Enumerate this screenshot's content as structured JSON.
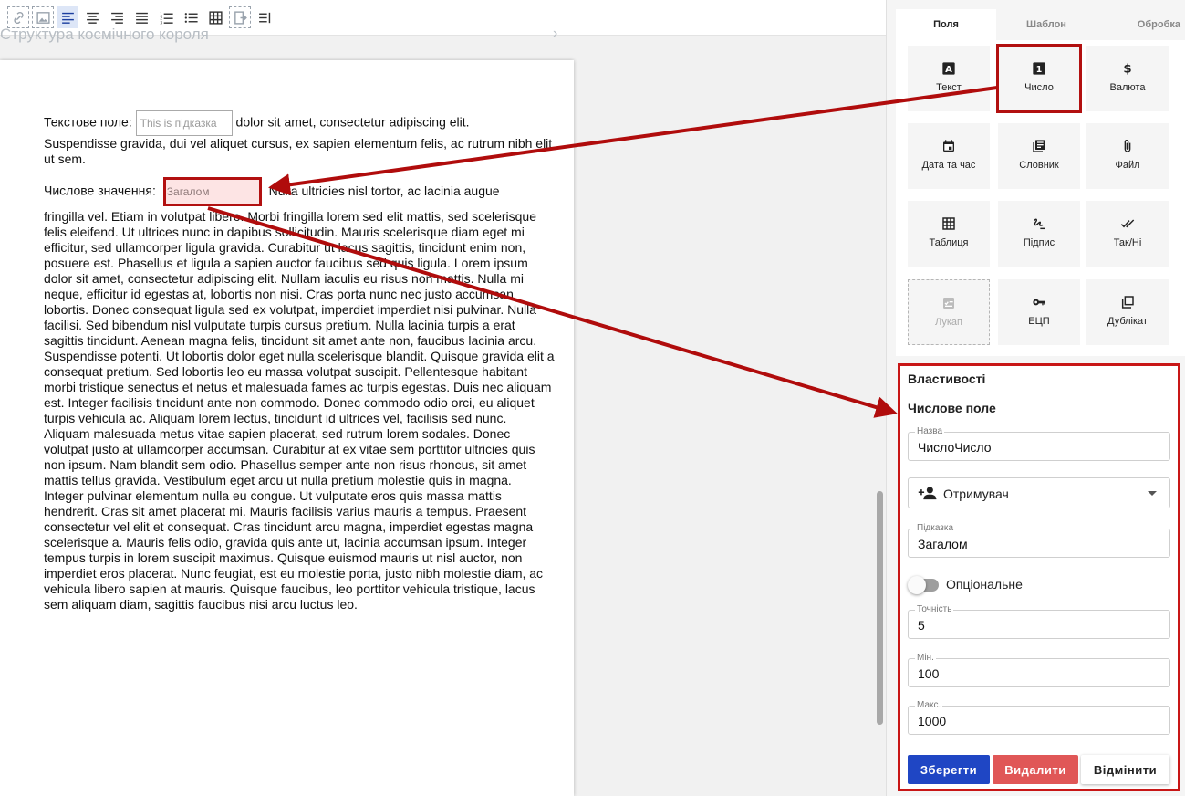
{
  "toolbar": {
    "buttons": [
      "link-icon",
      "image-icon",
      "align-left-icon",
      "align-center-icon",
      "align-right-icon",
      "align-justify-icon",
      "ordered-list-icon",
      "bullet-list-icon",
      "table-icon",
      "insert-field-icon",
      "text-direction-icon"
    ]
  },
  "document": {
    "faded_title": "Структура космічного короля",
    "p1_label": "Текстове поле:",
    "p1_placeholder": "This is підказка",
    "p1_after": " dolor sit amet, consectetur adipiscing elit.",
    "p1_rest": "Suspendisse gravida, dui vel aliquet cursus, ex sapien elementum felis, ac rutrum nibh elit ut sem.",
    "p2_label": "Числове значення:",
    "p2_placeholder": "Загалом",
    "p2_after": "Nulla ultricies nisl tortor, ac lacinia augue",
    "p2_body": "fringilla vel. Etiam in volutpat libero. Morbi fringilla lorem sed elit mattis, sed scelerisque felis eleifend. Ut ultrices nunc in dapibus sollicitudin. Mauris scelerisque diam eget mi efficitur, sed ullamcorper ligula gravida. Curabitur ut lacus sagittis, tincidunt enim non, posuere est. Phasellus et ligula a sapien auctor faucibus sed quis ligula. Lorem ipsum dolor sit amet, consectetur adipiscing elit. Nullam iaculis eu risus non mattis. Nulla mi neque, efficitur id egestas at, lobortis non nisi. Cras porta nunc nec justo accumsan lobortis. Donec consequat ligula sed ex volutpat, imperdiet imperdiet nisi pulvinar. Nulla facilisi. Sed bibendum nisl vulputate turpis cursus pretium. Nulla lacinia turpis a erat sagittis tincidunt. Aenean magna felis, tincidunt sit amet ante non, faucibus lacinia arcu. Suspendisse potenti. Ut lobortis dolor eget nulla scelerisque blandit. Quisque gravida elit a consequat pretium. Sed lobortis leo eu massa volutpat suscipit. Pellentesque habitant morbi tristique senectus et netus et malesuada fames ac turpis egestas. Duis nec aliquam est. Integer facilisis tincidunt ante non commodo. Donec commodo odio orci, eu aliquet turpis vehicula ac. Aliquam lorem lectus, tincidunt id ultrices vel, facilisis sed nunc. Aliquam malesuada metus vitae sapien placerat, sed rutrum lorem sodales. Donec volutpat justo at ullamcorper accumsan. Curabitur at ex vitae sem porttitor ultricies quis non ipsum. Nam blandit sem odio. Phasellus semper ante non risus rhoncus, sit amet mattis tellus gravida. Vestibulum eget arcu ut nulla pretium molestie quis in magna. Integer pulvinar elementum nulla eu congue. Ut vulputate eros quis massa mattis hendrerit. Cras sit amet placerat mi. Mauris facilisis varius mauris a tempus. Praesent consectetur vel elit et consequat. Cras tincidunt arcu magna, imperdiet egestas magna scelerisque a. Mauris felis odio, gravida quis ante ut, lacinia accumsan ipsum. Integer tempus turpis in lorem suscipit maximus. Quisque euismod mauris ut nisl auctor, non imperdiet eros placerat. Nunc feugiat, est eu molestie porta, justo nibh molestie diam, ac vehicula libero sapien at mauris. Quisque faucibus, leo porttitor vehicula tristique, lacus sem aliquam diam, sagittis faucibus nisi arcu luctus leo."
  },
  "panel": {
    "tabs": [
      "Поля",
      "Шаблон",
      "Обробка"
    ],
    "fields": [
      {
        "label": "Текст",
        "icon": "text-icon"
      },
      {
        "label": "Число",
        "icon": "number-icon"
      },
      {
        "label": "Валюта",
        "icon": "dollar-icon"
      },
      {
        "label": "Дата та час",
        "icon": "calendar-icon"
      },
      {
        "label": "Словник",
        "icon": "library-icon"
      },
      {
        "label": "Файл",
        "icon": "paperclip-icon"
      },
      {
        "label": "Таблиця",
        "icon": "grid-icon"
      },
      {
        "label": "Підпис",
        "icon": "signature-icon"
      },
      {
        "label": "Так/Ні",
        "icon": "double-check-icon"
      },
      {
        "label": "Лукап",
        "icon": "lookup-icon"
      },
      {
        "label": "ЕЦП",
        "icon": "key-icon"
      },
      {
        "label": "Дублікат",
        "icon": "duplicate-icon"
      }
    ],
    "properties": {
      "title": "Властивості",
      "subtitle": "Числове поле",
      "name_label": "Назва",
      "name_value": "ЧислоЧисло",
      "recipient_value": "Отримувач",
      "hint_label": "Підказка",
      "hint_value": "Загалом",
      "optional_label": "Опціональне",
      "optional_on": false,
      "precision_label": "Точність",
      "precision_value": "5",
      "min_label": "Мін.",
      "min_value": "100",
      "max_label": "Макс.",
      "max_value": "1000",
      "save_label": "Зберегти",
      "delete_label": "Видалити",
      "cancel_label": "Відмінити"
    }
  },
  "colors": {
    "highlight": "#b21010",
    "primary": "#1f46c4",
    "danger": "#e05757"
  }
}
